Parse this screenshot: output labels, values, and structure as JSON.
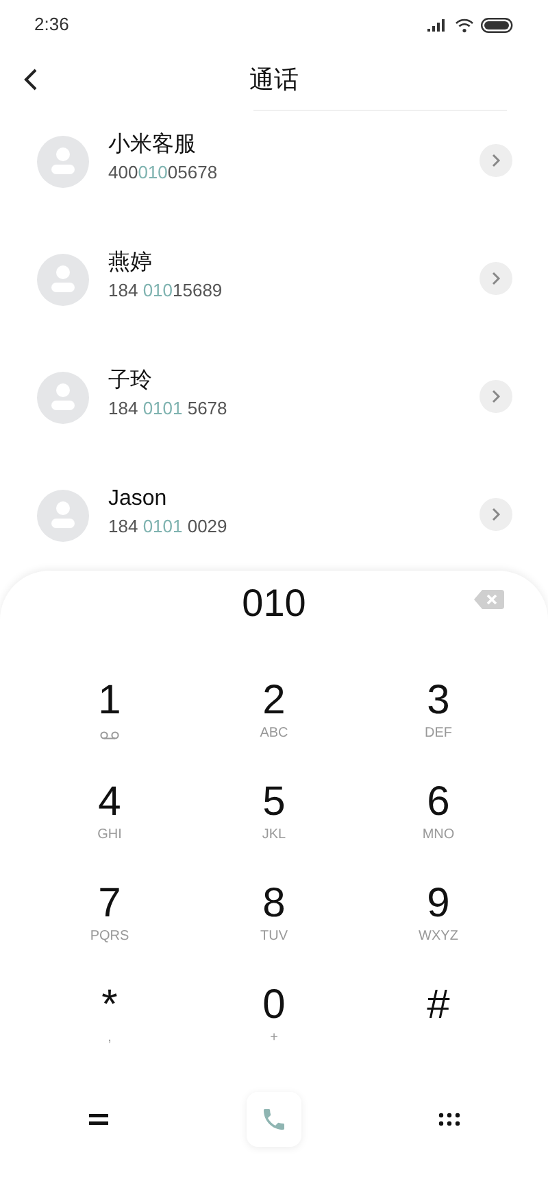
{
  "status_bar": {
    "time": "2:36"
  },
  "header": {
    "title": "通话"
  },
  "contacts": [
    {
      "name": "小米客服",
      "number": [
        {
          "text": "400",
          "match": false
        },
        {
          "text": "010",
          "match": true
        },
        {
          "text": "05678",
          "match": false
        }
      ]
    },
    {
      "name": "燕婷",
      "number": [
        {
          "text": "184 ",
          "match": false
        },
        {
          "text": "010",
          "match": true
        },
        {
          "text": "15689",
          "match": false
        }
      ]
    },
    {
      "name": "子玲",
      "number": [
        {
          "text": "184 ",
          "match": false
        },
        {
          "text": "0101",
          "match": true
        },
        {
          "text": " 5678",
          "match": false
        }
      ]
    },
    {
      "name": "Jason",
      "number": [
        {
          "text": "184 ",
          "match": false
        },
        {
          "text": "0101",
          "match": true
        },
        {
          "text": " 0029",
          "match": false
        }
      ]
    }
  ],
  "dialpad": {
    "entered": "010",
    "keys": [
      {
        "digit": "1",
        "kind": "voicemail"
      },
      {
        "digit": "2",
        "kind": "letters",
        "sub": "ABC"
      },
      {
        "digit": "3",
        "kind": "letters",
        "sub": "DEF"
      },
      {
        "digit": "4",
        "kind": "letters",
        "sub": "GHI"
      },
      {
        "digit": "5",
        "kind": "letters",
        "sub": "JKL"
      },
      {
        "digit": "6",
        "kind": "letters",
        "sub": "MNO"
      },
      {
        "digit": "7",
        "kind": "letters",
        "sub": "PQRS"
      },
      {
        "digit": "8",
        "kind": "letters",
        "sub": "TUV"
      },
      {
        "digit": "9",
        "kind": "letters",
        "sub": "WXYZ"
      },
      {
        "digit": "*",
        "kind": "letters",
        "sub": ","
      },
      {
        "digit": "0",
        "kind": "letters",
        "sub": "+"
      },
      {
        "digit": "#",
        "kind": "plain"
      }
    ]
  }
}
